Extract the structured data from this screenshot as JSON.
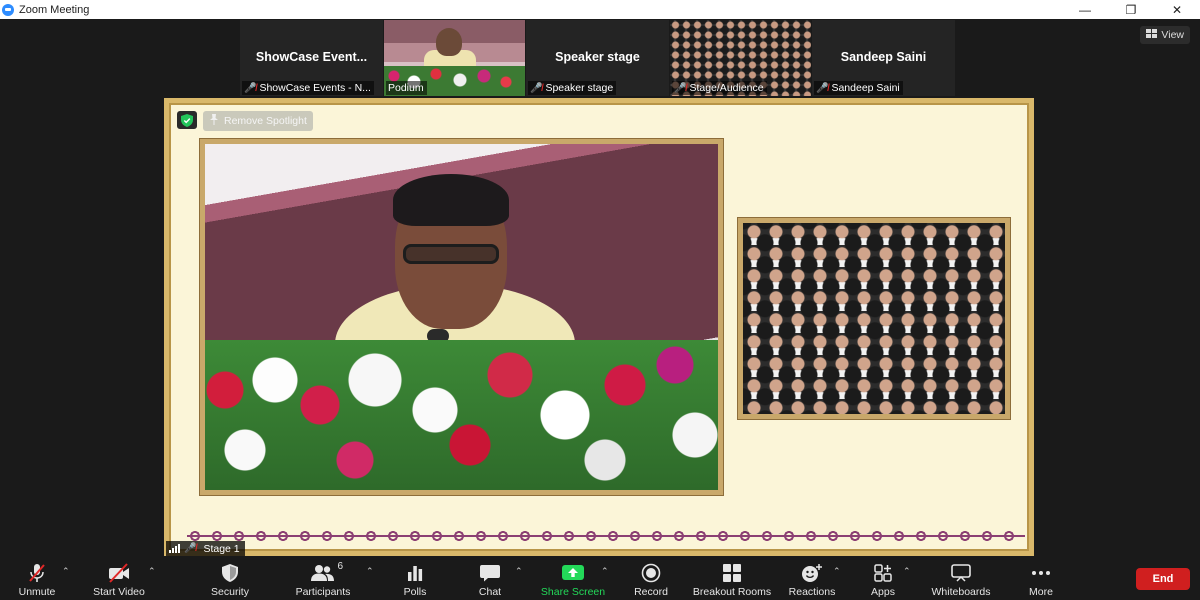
{
  "window": {
    "title": "Zoom Meeting",
    "controls": {
      "minimize": "—",
      "restore": "❐",
      "close": "✕"
    }
  },
  "view_button": {
    "label": "View"
  },
  "thumbnails": [
    {
      "display_name": "ShowCase  Event...",
      "label": "ShowCase Events - N...",
      "type": "name"
    },
    {
      "display_name": "",
      "label": "Podium",
      "type": "video-podium"
    },
    {
      "display_name": "Speaker stage",
      "label": "Speaker stage",
      "type": "name"
    },
    {
      "display_name": "",
      "label": "Stage/Audience",
      "type": "video-audience"
    },
    {
      "display_name": "Sandeep Saini",
      "label": "Sandeep Saini",
      "type": "name"
    }
  ],
  "stage": {
    "spotlight_label": "Remove Spotlight",
    "participant_label": "Stage 1"
  },
  "toolbar": {
    "unmute": "Unmute",
    "start_video": "Start Video",
    "security": "Security",
    "participants": "Participants",
    "participants_count": "6",
    "polls": "Polls",
    "chat": "Chat",
    "share_screen": "Share Screen",
    "record": "Record",
    "breakout_rooms": "Breakout Rooms",
    "reactions": "Reactions",
    "apps": "Apps",
    "whiteboards": "Whiteboards",
    "more": "More",
    "end": "End"
  },
  "colors": {
    "share_green": "#23d959",
    "end_red": "#d01f1f",
    "mute_red": "#e02828",
    "stage_gold": "#d9b86a",
    "stage_cream": "#fbf5d8",
    "ornament_purple": "#8b3f73"
  }
}
